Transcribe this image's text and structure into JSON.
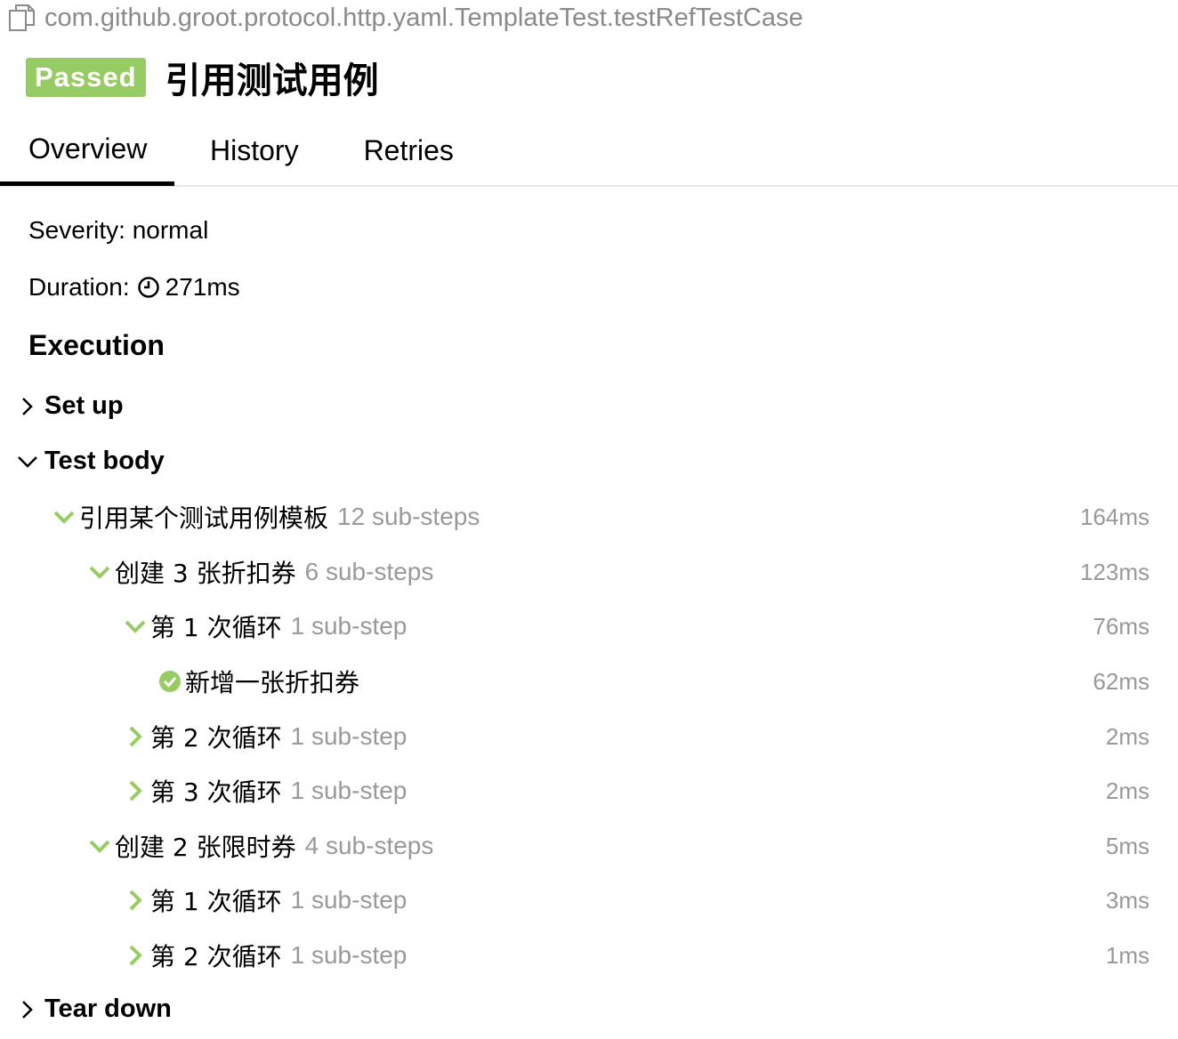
{
  "breadcrumb": {
    "path": "com.github.groot.protocol.http.yaml.TemplateTest.testRefTestCase",
    "icon": "copy-icon"
  },
  "test": {
    "status": "Passed",
    "title": "引用测试用例",
    "status_color": "#97cc64"
  },
  "tabs": [
    {
      "label": "Overview",
      "active": true
    },
    {
      "label": "History",
      "active": false
    },
    {
      "label": "Retries",
      "active": false
    }
  ],
  "overview": {
    "severity": "Severity: normal",
    "duration_label": "Duration:",
    "duration_value": "271ms",
    "execution_heading": "Execution"
  },
  "sections": {
    "setup": "Set up",
    "body": "Test body",
    "teardown": "Tear down"
  },
  "steps": [
    {
      "name": "引用某个测试用例模板",
      "substeps": "12 sub-steps",
      "duration": "164ms",
      "icon": "chevron-down-icon"
    },
    {
      "name": "创建 3 张折扣券",
      "substeps": "6 sub-steps",
      "duration": "123ms",
      "icon": "chevron-down-icon"
    },
    {
      "name": "第 1 次循环",
      "substeps": "1 sub-step",
      "duration": "76ms",
      "icon": "chevron-down-icon"
    },
    {
      "name": "新增一张折扣券",
      "substeps": "",
      "duration": "62ms",
      "icon": "check-circle-icon"
    },
    {
      "name": "第 2 次循环",
      "substeps": "1 sub-step",
      "duration": "2ms",
      "icon": "chevron-right-icon"
    },
    {
      "name": "第 3 次循环",
      "substeps": "1 sub-step",
      "duration": "2ms",
      "icon": "chevron-right-icon"
    },
    {
      "name": "创建 2 张限时券",
      "substeps": "4 sub-steps",
      "duration": "5ms",
      "icon": "chevron-down-icon"
    },
    {
      "name": "第 1 次循环",
      "substeps": "1 sub-step",
      "duration": "3ms",
      "icon": "chevron-right-icon"
    },
    {
      "name": "第 2 次循环",
      "substeps": "1 sub-step",
      "duration": "1ms",
      "icon": "chevron-right-icon"
    }
  ]
}
